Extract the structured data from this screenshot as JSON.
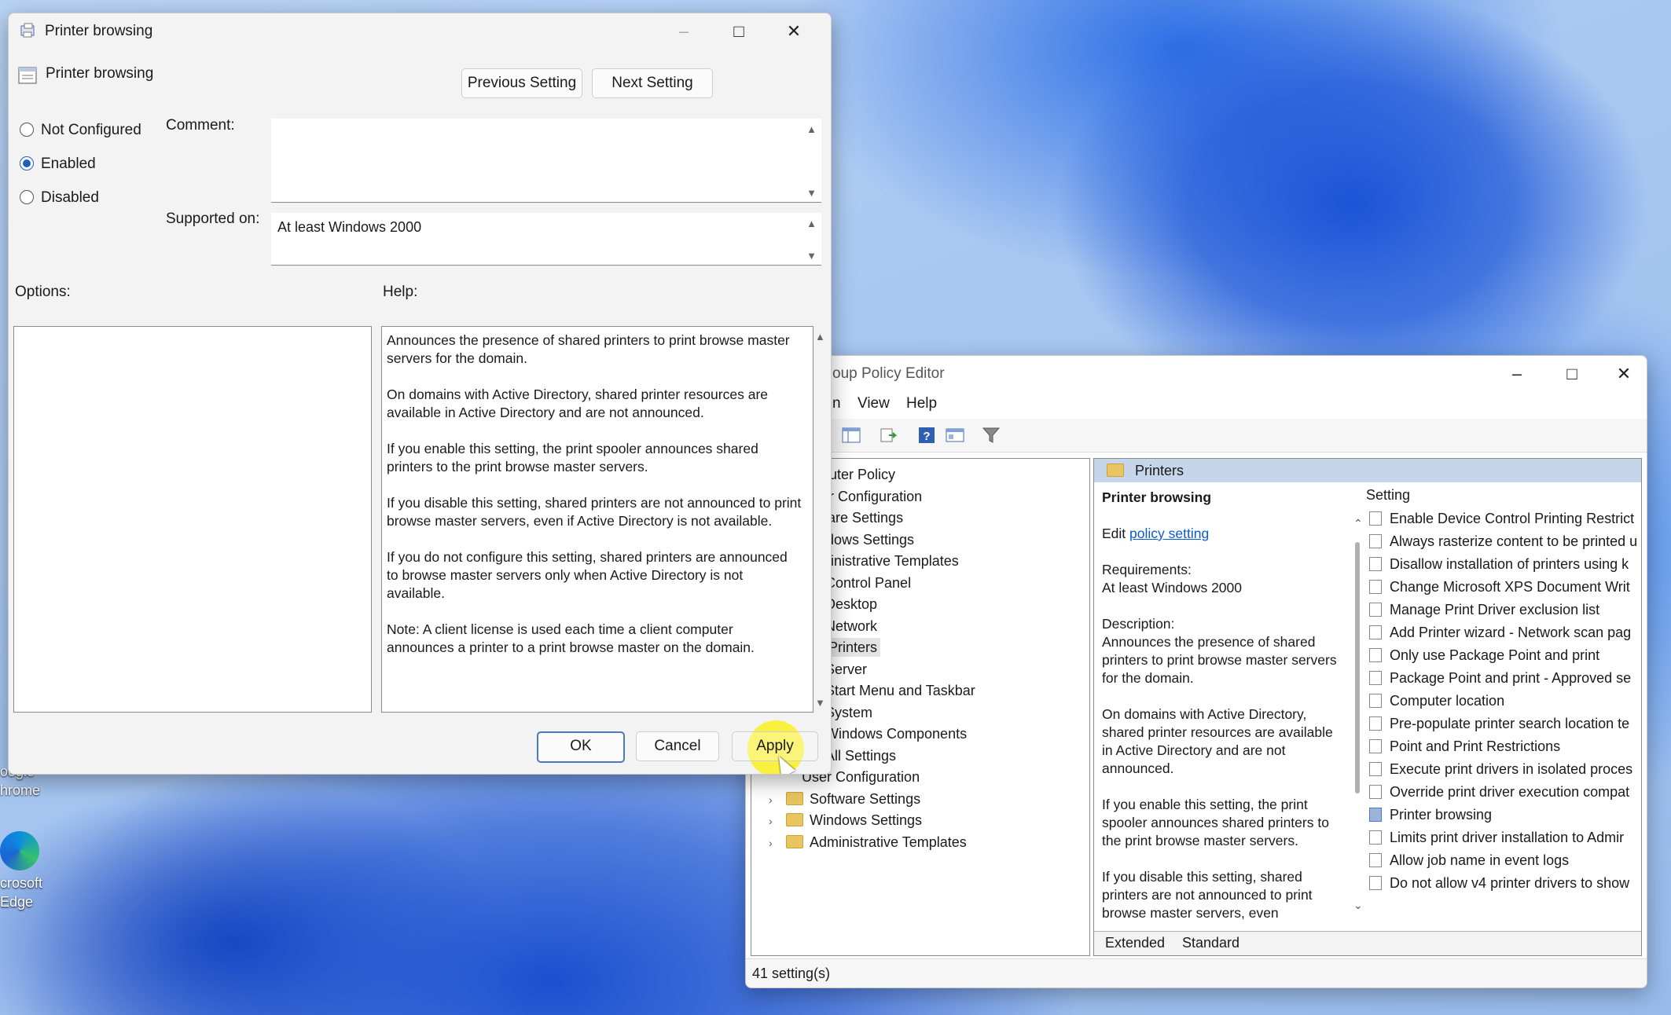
{
  "dialog": {
    "title": "Printer browsing",
    "policy_name": "Printer browsing",
    "prev_button": "Previous Setting",
    "next_button": "Next Setting",
    "radio_not_configured": "Not Configured",
    "radio_enabled": "Enabled",
    "radio_disabled": "Disabled",
    "selected_state": "Enabled",
    "comment_label": "Comment:",
    "comment_value": "",
    "supported_label": "Supported on:",
    "supported_value": "At least Windows 2000",
    "options_label": "Options:",
    "help_label": "Help:",
    "help_paragraphs": [
      "Announces the presence of shared printers to print browse master servers for the domain.",
      "On domains with Active Directory, shared printer resources are available in Active Directory and are not announced.",
      "If you enable this setting, the print spooler announces shared printers to the print browse master servers.",
      "If you disable this setting, shared printers are not announced to print browse master servers, even if Active Directory is not available.",
      "If you do not configure this setting, shared printers are announced to browse master servers only when Active Directory is not available.",
      "Note: A client license is used each time a client computer announces a printer to a print browse master on the domain."
    ],
    "ok_button": "OK",
    "cancel_button": "Cancel",
    "apply_button": "Apply"
  },
  "gpe": {
    "title_visible": "oup Policy Editor",
    "menu": [
      "n",
      "View",
      "Help"
    ],
    "tree": [
      {
        "label": "omputer Policy",
        "indent": 0,
        "kind": "plain"
      },
      {
        "label": "puter Configuration",
        "indent": 0,
        "kind": "plain"
      },
      {
        "label": "oftware Settings",
        "indent": 0,
        "kind": "plain"
      },
      {
        "label": "Windows Settings",
        "indent": 0,
        "kind": "plain"
      },
      {
        "label": "Administrative Templates",
        "indent": 0,
        "kind": "plain"
      },
      {
        "label": "Control Panel",
        "indent": 1,
        "kind": "folder"
      },
      {
        "label": "Desktop",
        "indent": 1,
        "kind": "folder"
      },
      {
        "label": "Network",
        "indent": 1,
        "kind": "folder"
      },
      {
        "label": "Printers",
        "indent": 1,
        "kind": "folder",
        "selected": true
      },
      {
        "label": "Server",
        "indent": 1,
        "kind": "folder"
      },
      {
        "label": "Start Menu and Taskbar",
        "indent": 1,
        "kind": "folder"
      },
      {
        "label": "System",
        "indent": 1,
        "kind": "folder"
      },
      {
        "label": "Windows Components",
        "indent": 1,
        "kind": "folder"
      },
      {
        "label": "All Settings",
        "indent": 1,
        "kind": "folder"
      },
      {
        "label": "User Configuration",
        "indent": 0,
        "kind": "plain"
      },
      {
        "label": "Software Settings",
        "indent": 2,
        "kind": "expand"
      },
      {
        "label": "Windows Settings",
        "indent": 2,
        "kind": "expand"
      },
      {
        "label": "Administrative Templates",
        "indent": 2,
        "kind": "expand"
      }
    ],
    "pane_header": "Printers",
    "desc_title": "Printer browsing",
    "edit_prefix": "Edit ",
    "edit_link": "policy setting",
    "requirements_label": "Requirements:",
    "requirements_value": "At least Windows 2000",
    "description_label": "Description:",
    "desc_paragraphs": [
      "Announces the presence of shared printers to print browse master servers for the domain.",
      "On domains with Active Directory, shared printer resources are available in Active Directory and are not announced.",
      "If you enable this setting, the print spooler announces shared printers to the print browse master servers.",
      "If you disable this setting, shared printers are not announced to print browse master servers, even"
    ],
    "settings_header": "Setting",
    "settings": [
      "Enable Device Control Printing Restrict",
      "Always rasterize content to be printed u",
      "Disallow installation of printers using k",
      "Change Microsoft XPS Document Writ",
      "Manage Print Driver exclusion list",
      "Add Printer wizard - Network scan pag",
      "Only use Package Point and print",
      "Package Point and print - Approved se",
      "Computer location",
      "Pre-populate printer search location te",
      "Point and Print Restrictions",
      "Execute print drivers in isolated proces",
      "Override print driver execution compat",
      "Printer browsing",
      "Limits print driver installation to Admir",
      "Allow job name in event logs",
      "Do not allow v4 printer drivers to show"
    ],
    "selected_setting": "Printer browsing",
    "tab_extended": "Extended",
    "tab_standard": "Standard",
    "status": "41 setting(s)"
  },
  "desktop": {
    "icon1_label_1": "oogle",
    "icon1_label_2": "hrome",
    "icon2_label_1": "crosoft",
    "icon2_label_2": "Edge"
  }
}
